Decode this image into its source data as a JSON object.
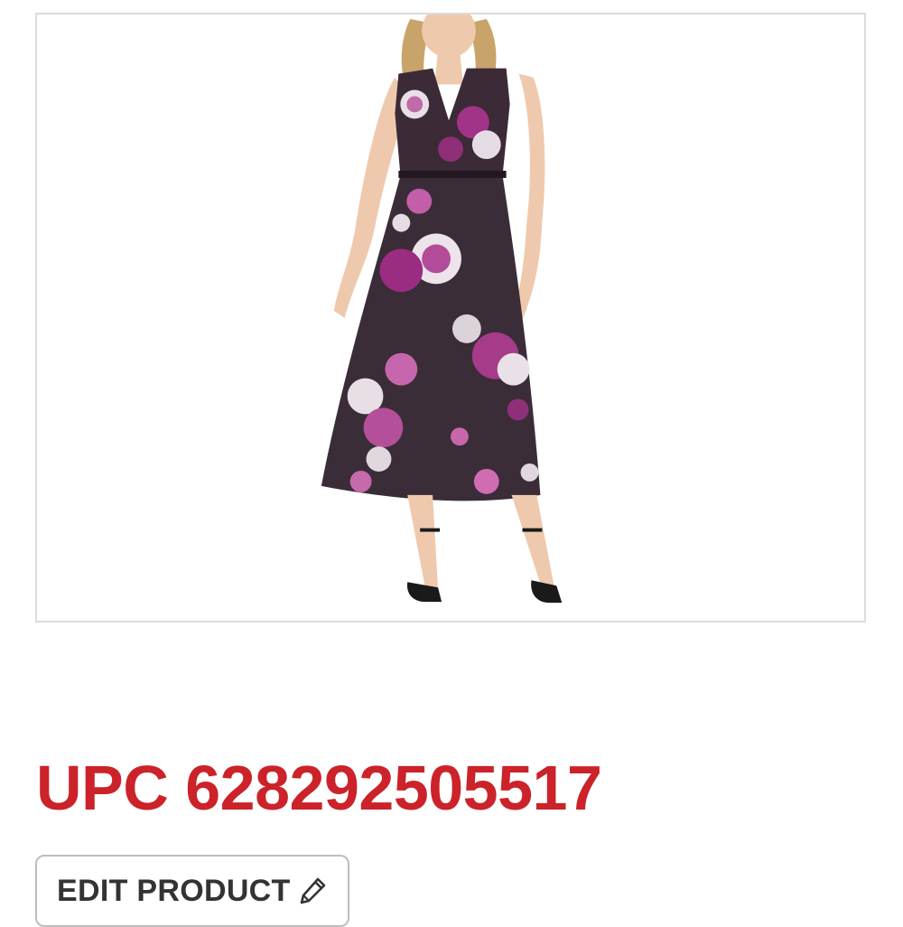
{
  "product": {
    "image_icon": "product-photo",
    "upc_text": "UPC 628292505517",
    "upc_color": "#cc2229"
  },
  "actions": {
    "edit_label": "EDIT PRODUCT",
    "edit_icon": "pencil-icon"
  }
}
